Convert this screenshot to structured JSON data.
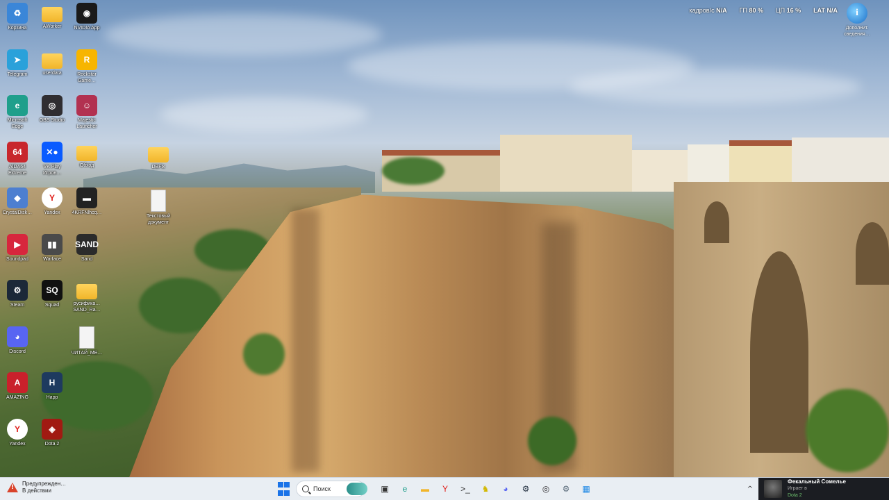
{
  "desktop": {
    "icons": [
      {
        "label": "Корзина",
        "icon": "recycle-bin-icon",
        "glyph": "♻",
        "color": "#3a86d8",
        "col": 0,
        "row": 0
      },
      {
        "label": "AWorker",
        "icon": "folder-icon",
        "glyph": "",
        "color": "#f1b52a",
        "col": 1,
        "row": 0
      },
      {
        "label": "NVIDIA App",
        "icon": "nvidia-icon",
        "glyph": "◉",
        "color": "#1a1a1a",
        "col": 2,
        "row": 0
      },
      {
        "label": "Telegram",
        "icon": "telegram-icon",
        "glyph": "➤",
        "color": "#2aa1da",
        "col": 0,
        "row": 1
      },
      {
        "label": "userdata",
        "icon": "folder-icon",
        "glyph": "",
        "color": "#f1b52a",
        "col": 1,
        "row": 1
      },
      {
        "label": "Rockstar\nGame…",
        "icon": "rockstar-icon",
        "glyph": "R",
        "color": "#f7b500",
        "col": 2,
        "row": 1
      },
      {
        "label": "Microsoft\nEdge",
        "icon": "edge-icon",
        "glyph": "e",
        "color": "#1f9f8b",
        "col": 0,
        "row": 2
      },
      {
        "label": "OBS Studio",
        "icon": "obs-icon",
        "glyph": "◎",
        "color": "#302e31",
        "col": 1,
        "row": 2
      },
      {
        "label": "Majestic\nLauncher",
        "icon": "majestic-icon",
        "glyph": "☺",
        "color": "#b23150",
        "col": 2,
        "row": 2
      },
      {
        "label": "AIDA64\nExtreme",
        "icon": "aida64-icon",
        "glyph": "64",
        "color": "#c8262c",
        "col": 0,
        "row": 3
      },
      {
        "label": "VK Play\nИгров…",
        "icon": "vkplay-icon",
        "glyph": "✕●",
        "color": "#0a5bff",
        "col": 1,
        "row": 3
      },
      {
        "label": "Обход",
        "icon": "folder-icon",
        "glyph": "",
        "color": "#f1b52a",
        "col": 2,
        "row": 3
      },
      {
        "label": "CrystalDisk…",
        "icon": "crystaldisk-icon",
        "glyph": "◆",
        "color": "#4d7fd0",
        "col": 0,
        "row": 4
      },
      {
        "label": "Yandex",
        "icon": "yandex-icon",
        "glyph": "Y",
        "color": "#ffffff",
        "col": 1,
        "row": 4
      },
      {
        "label": "4KRFNlhcq…",
        "icon": "shortcut-icon",
        "glyph": "▬",
        "color": "#222222",
        "col": 2,
        "row": 4
      },
      {
        "label": "Soundpad",
        "icon": "soundpad-icon",
        "glyph": "▶",
        "color": "#d7263d",
        "col": 0,
        "row": 5
      },
      {
        "label": "Warface",
        "icon": "warface-icon",
        "glyph": "▮▮",
        "color": "#4a4a4a",
        "col": 1,
        "row": 5
      },
      {
        "label": "Sand",
        "icon": "sand-icon",
        "glyph": "SAND",
        "color": "#2b2b2b",
        "col": 2,
        "row": 5
      },
      {
        "label": "Steam",
        "icon": "steam-icon",
        "glyph": "⚙",
        "color": "#1b2838",
        "col": 0,
        "row": 6
      },
      {
        "label": "Squad",
        "icon": "squad-icon",
        "glyph": "SQ",
        "color": "#111111",
        "col": 1,
        "row": 6
      },
      {
        "label": "русифика…\nSAND_Ra…",
        "icon": "folder-icon",
        "glyph": "",
        "color": "#f1b52a",
        "col": 2,
        "row": 6
      },
      {
        "label": "Discord",
        "icon": "discord-icon",
        "glyph": "◕",
        "color": "#5865f2",
        "col": 0,
        "row": 7
      },
      {
        "label": "ЧИТАЙ_МЕ…",
        "icon": "document-icon",
        "glyph": "",
        "color": "#ffffff",
        "col": 2,
        "row": 7
      },
      {
        "label": "AMAZING",
        "icon": "amazing-icon",
        "glyph": "A",
        "color": "#c9202b",
        "col": 0,
        "row": 8
      },
      {
        "label": "Happ",
        "icon": "happ-icon",
        "glyph": "H",
        "color": "#1e3a5f",
        "col": 1,
        "row": 8
      },
      {
        "label": "Yandex",
        "icon": "yandex-icon",
        "glyph": "Y",
        "color": "#ffffff",
        "col": 0,
        "row": 9
      },
      {
        "label": "Dota 2",
        "icon": "dota2-icon",
        "glyph": "◈",
        "color": "#a11a12",
        "col": 1,
        "row": 9
      }
    ],
    "extra_icons": [
      {
        "label": "DBFix",
        "icon": "folder-icon"
      },
      {
        "label": "Текстовый\nдокумент",
        "icon": "document-icon"
      }
    ]
  },
  "overlay": {
    "fps_label": "кадров/с",
    "fps_value": "N/A",
    "gpu_label": "ГП",
    "gpu_value": "80 %",
    "cpu_label": "ЦП",
    "cpu_value": "16 %",
    "lat_label": "LAT",
    "lat_value": "N/A"
  },
  "info_widget": {
    "label": "Дополнит.\nсведения…",
    "icon": "info-icon",
    "glyph": "i"
  },
  "taskbar": {
    "warning": {
      "line1": "Предупрежден…",
      "line2": "В действии",
      "icon": "warning-icon"
    },
    "search_placeholder": "Поиск",
    "pinned": [
      {
        "name": "task-view-button",
        "glyph": "▣",
        "color": "#333333"
      },
      {
        "name": "edge-taskbar-button",
        "glyph": "e",
        "color": "#1f9f8b"
      },
      {
        "name": "explorer-taskbar-button",
        "glyph": "▬",
        "color": "#f1b52a"
      },
      {
        "name": "yandex-taskbar-button",
        "glyph": "Y",
        "color": "#e0201c"
      },
      {
        "name": "terminal-taskbar-button",
        "glyph": ">_",
        "color": "#2b2b2b"
      },
      {
        "name": "app-yellow-taskbar-button",
        "glyph": "♞",
        "color": "#d2b800"
      },
      {
        "name": "discord-taskbar-button",
        "glyph": "◕",
        "color": "#5865f2"
      },
      {
        "name": "steam-taskbar-button",
        "glyph": "⚙",
        "color": "#1b2838"
      },
      {
        "name": "obs-taskbar-button",
        "glyph": "◎",
        "color": "#302e31"
      },
      {
        "name": "settings-taskbar-button",
        "glyph": "⚙",
        "color": "#5a6b7a"
      },
      {
        "name": "app-blue-taskbar-button",
        "glyph": "▦",
        "color": "#1e88e5"
      }
    ],
    "notification": {
      "name": "Фекальный Сомелье",
      "status": "Играет в",
      "game": "Dota 2"
    }
  }
}
